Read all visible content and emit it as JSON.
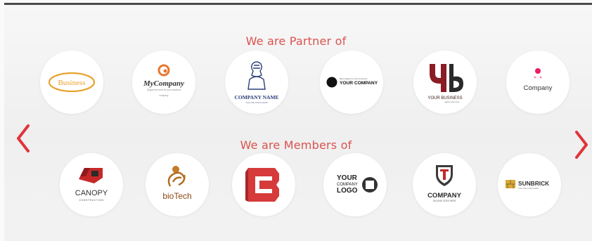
{
  "sections": {
    "partners_title": "We are Partner of",
    "members_title": "We are Members of"
  },
  "colors": {
    "accent": "#d9534f",
    "arrow": "#e0343a"
  },
  "navigation": {
    "prev_icon": "chevron-left-icon",
    "next_icon": "chevron-right-icon"
  },
  "partners": [
    {
      "name": "Business"
    },
    {
      "name": "MyCompany",
      "tagline": "Slogan text here for your business",
      "sub": "company"
    },
    {
      "name": "COMPANY NAME",
      "tagline": "TAGLINE GOES HERE"
    },
    {
      "name": "YOUR COMPANY",
      "tagline": "Best slogan for your business"
    },
    {
      "name": "YOUR BUSINESS",
      "tagline": "tagline goes here"
    },
    {
      "name": "Company"
    }
  ],
  "members": [
    {
      "name": "CANOPY",
      "sub": "CONSTRUCTION"
    },
    {
      "name": "bioTech"
    },
    {
      "name": "B"
    },
    {
      "name": "YOUR COMPANY LOGO",
      "lines": [
        "YOUR",
        "COMPANY",
        "LOGO"
      ]
    },
    {
      "name": "COMPANY",
      "tagline": "TAGLINE GOES HERE"
    },
    {
      "name": "SUNBRICK",
      "tagline": "TAGLINE GOES HERE"
    }
  ]
}
